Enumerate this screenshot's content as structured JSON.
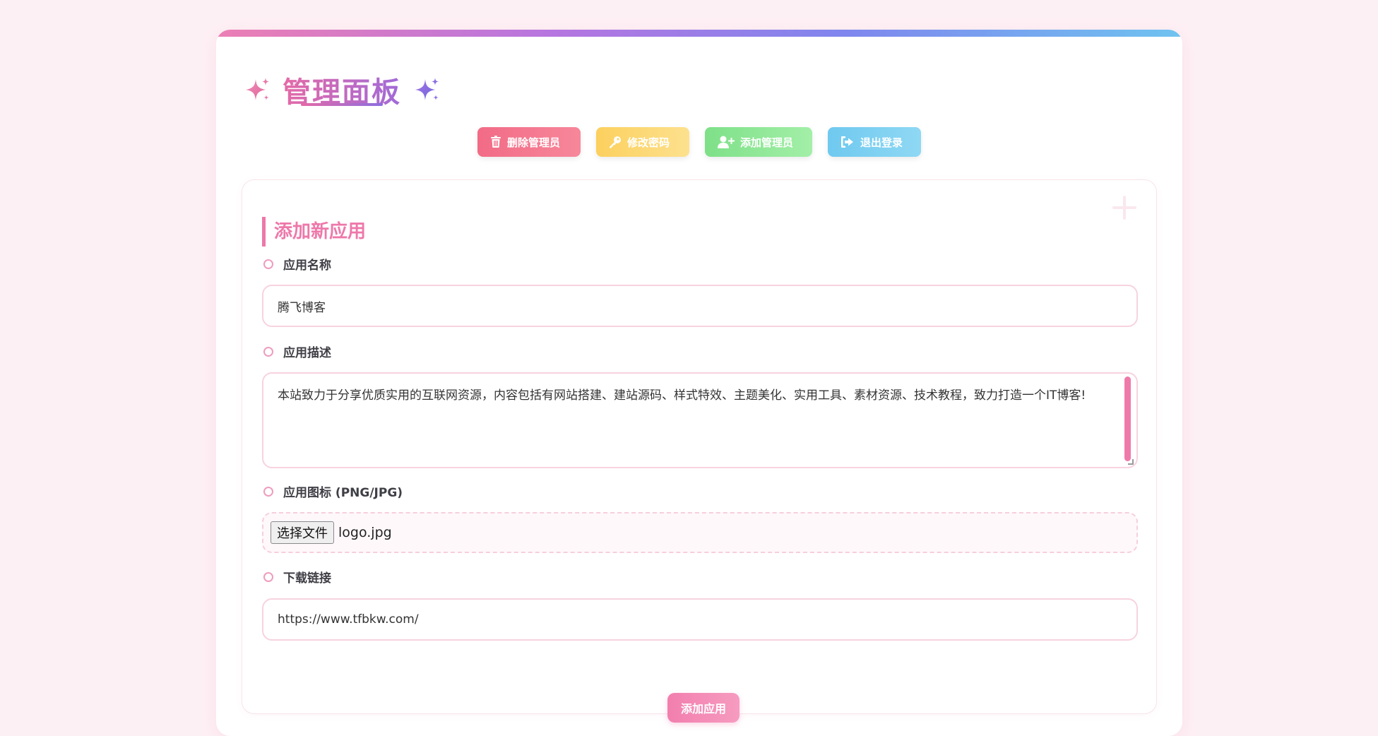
{
  "header": {
    "title": "管理面板"
  },
  "actions": {
    "delete_admin": "删除管理员",
    "change_password": "修改密码",
    "add_admin": "添加管理员",
    "logout": "退出登录"
  },
  "form": {
    "title": "添加新应用",
    "app_name": {
      "label": "应用名称",
      "value": "腾飞博客"
    },
    "app_description": {
      "label": "应用描述",
      "value": "本站致力于分享优质实用的互联网资源，内容包括有网站搭建、建站源码、样式特效、主题美化、实用工具、素材资源、技术教程，致力打造一个IT博客!"
    },
    "app_icon": {
      "label": "应用图标 (PNG/JPG)",
      "choose_label": "选择文件",
      "file_name": "logo.jpg"
    },
    "download_link": {
      "label": "下载链接",
      "value": "https://www.tfbkw.com/"
    },
    "submit_label": "添加应用"
  },
  "colors": {
    "accent_pink": "#ee78aa",
    "accent_purple": "#a06ad8",
    "delete": "#f26b86",
    "password": "#fcd05e",
    "add": "#7ee088",
    "logout": "#6fc9ef"
  },
  "icons": {
    "title_left": "sparkle-icon",
    "title_right": "sparkle-icon",
    "delete": "trash-icon",
    "password": "key-icon",
    "add_admin": "user-plus-icon",
    "logout": "sign-out-icon"
  }
}
